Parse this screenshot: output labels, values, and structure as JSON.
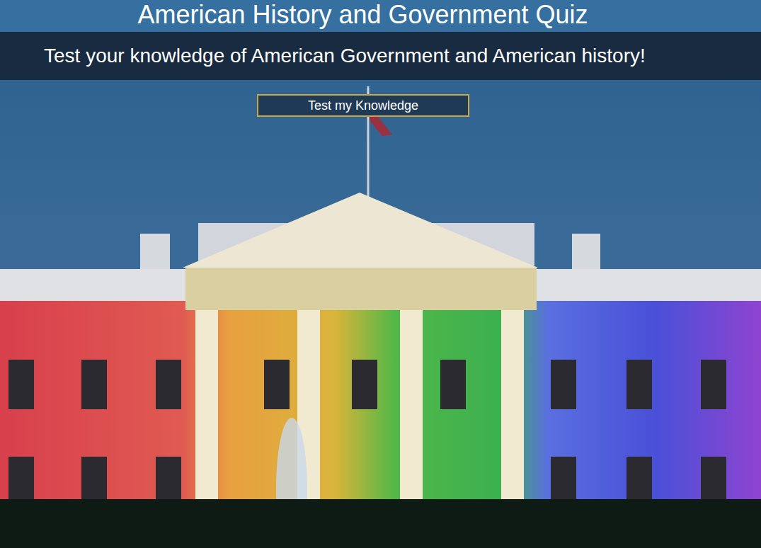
{
  "header": {
    "title": "American History and Government Quiz",
    "subtitle": "Test your knowledge of American Government and American history!"
  },
  "start_button": {
    "label": "Test my Knowledge"
  }
}
